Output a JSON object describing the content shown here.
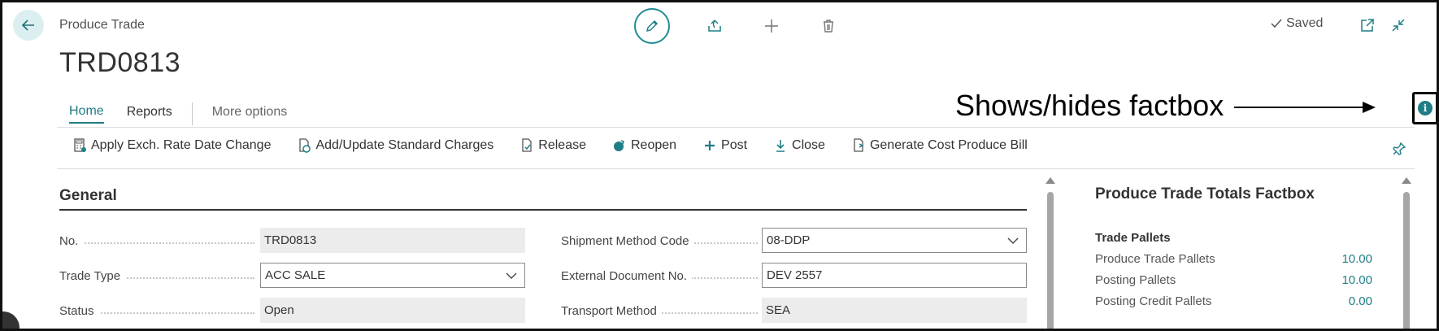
{
  "header": {
    "breadcrumb": "Produce Trade",
    "title": "TRD0813",
    "saved_label": "Saved"
  },
  "menu": {
    "tabs": [
      {
        "label": "Home",
        "active": true
      },
      {
        "label": "Reports",
        "active": false
      },
      {
        "label": "More options",
        "active": false
      }
    ]
  },
  "annotation": {
    "text": "Shows/hides factbox"
  },
  "actions": [
    {
      "label": "Apply Exch. Rate Date Change",
      "icon": "calculator-icon"
    },
    {
      "label": "Add/Update Standard Charges",
      "icon": "charges-icon"
    },
    {
      "label": "Release",
      "icon": "release-icon"
    },
    {
      "label": "Reopen",
      "icon": "reopen-icon"
    },
    {
      "label": "Post",
      "icon": "post-icon"
    },
    {
      "label": "Close",
      "icon": "close-down-arrow-icon"
    },
    {
      "label": "Generate Cost Produce Bill",
      "icon": "generate-bill-icon"
    }
  ],
  "general": {
    "title": "General",
    "fields": {
      "no": {
        "label": "No.",
        "value": "TRD0813"
      },
      "trade_type": {
        "label": "Trade Type",
        "value": "ACC SALE"
      },
      "status": {
        "label": "Status",
        "value": "Open"
      },
      "shipment_method": {
        "label": "Shipment Method Code",
        "value": "08-DDP"
      },
      "external_doc": {
        "label": "External Document No.",
        "value": "DEV 2557"
      },
      "transport_method": {
        "label": "Transport Method",
        "value": "SEA"
      }
    }
  },
  "factbox": {
    "title": "Produce Trade Totals Factbox",
    "group": "Trade Pallets",
    "rows": [
      {
        "label": "Produce Trade Pallets",
        "value": "10.00"
      },
      {
        "label": "Posting Pallets",
        "value": "10.00"
      },
      {
        "label": "Posting Credit Pallets",
        "value": "0.00"
      }
    ]
  },
  "colors": {
    "accent": "#1f7e86",
    "readonly_bg": "#ececec"
  }
}
